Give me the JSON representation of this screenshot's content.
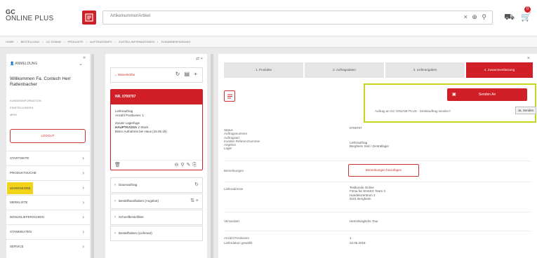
{
  "header": {
    "logo_line1": "GC",
    "logo_line2": "ONLINE PLUS",
    "search_value": "Artikelnummer/Artikel",
    "search_icons": "× ⊕ ⚲",
    "cart_count": "0"
  },
  "breadcrumb": [
    "HOME",
    "›",
    "BESTELLUNG",
    "›",
    "GC STAMM",
    "›",
    "PRODUKTE",
    "›",
    "AUFTRAGSINFO",
    "›",
    "ZUSTELLINFORMATIONEN",
    "›",
    "ZUSAMMENFASSUNG"
  ],
  "sidebar": {
    "collapse": "«",
    "user_label": "ANMELDUNG",
    "welcome": "Willkommen Fa. Contech Herr Rattenbacher",
    "links": [
      "KUNDENINFORMATION",
      "EINSTELLUNGEN",
      "MEIN"
    ],
    "logout_label": "LOGOUT",
    "menu": [
      {
        "label": "STARTSEITE",
        "active": false
      },
      {
        "label": "PRODUKTSUCHE",
        "active": false
      },
      {
        "label": "WARENKORB",
        "active": true
      },
      {
        "label": "MERKLISTE",
        "active": false
      },
      {
        "label": "BONUSLIEFERSCHEIN",
        "active": false
      },
      {
        "label": "STAMMDATEN",
        "active": false
      },
      {
        "label": "SERVICE",
        "active": false
      }
    ]
  },
  "middle": {
    "top_icons": "⇄ «",
    "header_title": "Warenkörbe",
    "header_icons": "↻ ▤ +",
    "order": {
      "number": "NR. 0709707",
      "type": "Lieferauftrag",
      "positions": "Anzahl Positionen: 1",
      "extra_label": "Zusatz Lagerfuge",
      "main_label": "HAUPTKASSA",
      "main_value": "2 Stück",
      "note": "Bistro Aufnahme bei Haus (15.05.18)"
    },
    "list": [
      {
        "label": "Dauerauftrag",
        "icon": "↻"
      },
      {
        "label": "Bestellhandhaben (Angebot)",
        "icon": "⇅ +"
      },
      {
        "label": "Schnellbestellliste",
        "icon": ""
      },
      {
        "label": "Bestellhaben (Lieferant)",
        "icon": ""
      }
    ]
  },
  "right": {
    "close": "×",
    "steps": [
      "1. Produkte",
      "2. Auftragsdaten",
      "3. Lieferangaben",
      "4. Zusammenfassung"
    ],
    "popup": {
      "button_label": "Senden An",
      "question": "Auftrag an GC ONLINE PLUS · Direktauftrag senden?",
      "yes_label": "Ja, Senden"
    },
    "labels_block": [
      "Status",
      "Auftragsnummer",
      "Auftragsart",
      "Kunden Referenznummer",
      "Angebot",
      "Lager"
    ],
    "values_block": [
      "0709707",
      "",
      "",
      "",
      "Lieferauftrag",
      "Bergheim Süd / Zentrallager"
    ],
    "remarks_label": "Bemerkungen",
    "remarks_button": "Bemerkungen hinzufügen",
    "delivery_label": "Lieferadresse",
    "delivery_lines": [
      "Testkunde Online",
      "Firma für SHKEG Team 3",
      "Handelszentrum 3",
      "5101 Bergheim"
    ],
    "shipping_label": "Versandart",
    "shipping_value": "Hemmkingliche Tour",
    "count_label": "Anzahl Positionen",
    "count_value": "1",
    "date_label": "Lieferdatum gewählt",
    "date_value": "22.05.2018"
  }
}
